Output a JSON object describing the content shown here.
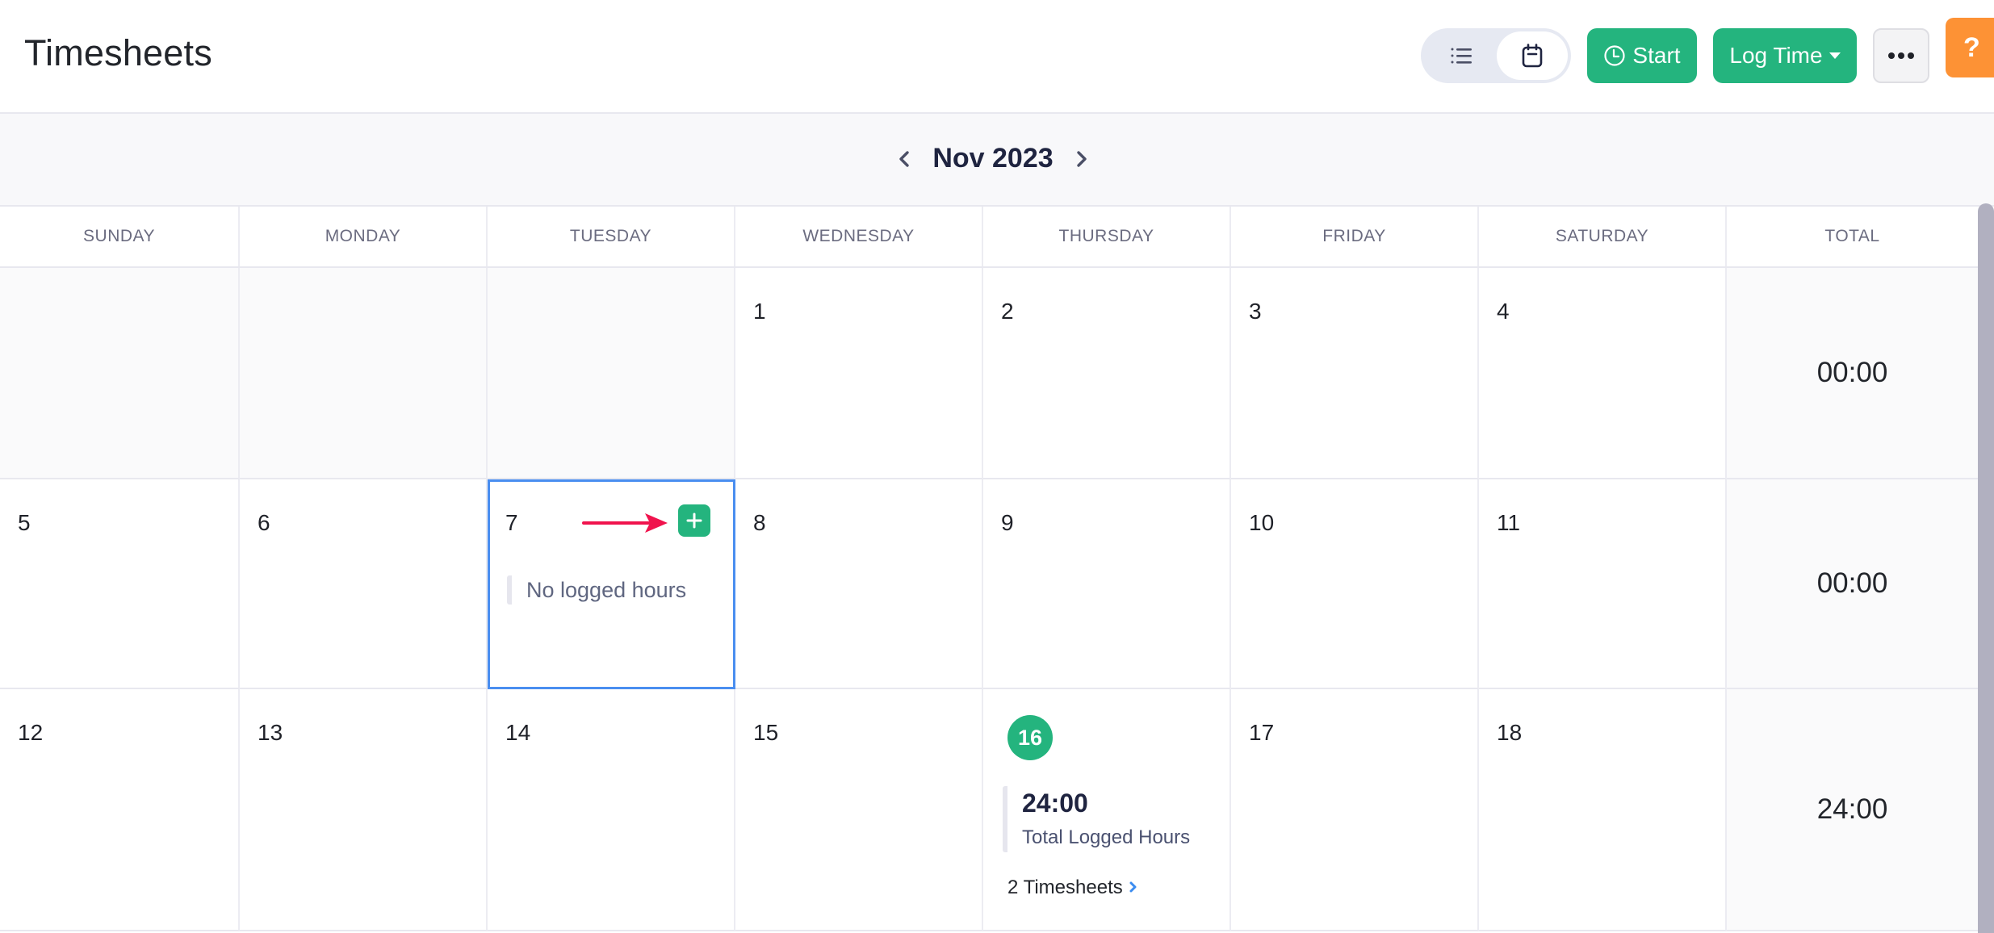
{
  "header": {
    "title": "Timesheets",
    "view_toggle": {
      "options": [
        {
          "name": "list-view",
          "icon": "list-icon",
          "active": false
        },
        {
          "name": "calendar-view",
          "icon": "calendar-icon",
          "active": true
        }
      ]
    },
    "buttons": {
      "start_label": "Start",
      "start_icon": "clock-icon",
      "log_time_label": "Log Time",
      "more_icon": "more-horizontal-icon",
      "help_label": "?"
    },
    "colors": {
      "primary": "#24b47e",
      "help": "#fd9235",
      "selected_border": "#4a8ef0",
      "annotation_arrow": "#f0134d"
    }
  },
  "calendar": {
    "month_label": "Nov 2023",
    "weekdays": [
      "SUNDAY",
      "MONDAY",
      "TUESDAY",
      "WEDNESDAY",
      "THURSDAY",
      "FRIDAY",
      "SATURDAY",
      "TOTAL"
    ],
    "weeks": [
      {
        "days": [
          {
            "num": "",
            "empty": true
          },
          {
            "num": "",
            "empty": true
          },
          {
            "num": "",
            "empty": true
          },
          {
            "num": "1"
          },
          {
            "num": "2"
          },
          {
            "num": "3"
          },
          {
            "num": "4"
          }
        ],
        "total": "00:00"
      },
      {
        "days": [
          {
            "num": "5"
          },
          {
            "num": "6"
          },
          {
            "num": "7",
            "selected": true,
            "status": "No logged hours"
          },
          {
            "num": "8"
          },
          {
            "num": "9"
          },
          {
            "num": "10"
          },
          {
            "num": "11"
          }
        ],
        "total": "00:00"
      },
      {
        "days": [
          {
            "num": "12"
          },
          {
            "num": "13"
          },
          {
            "num": "14"
          },
          {
            "num": "15"
          },
          {
            "num": "16",
            "today": true,
            "hours": "24:00",
            "hours_caption": "Total Logged Hours",
            "timesheets_link": "2 Timesheets"
          },
          {
            "num": "17"
          },
          {
            "num": "18"
          }
        ],
        "total": "24:00"
      }
    ]
  }
}
